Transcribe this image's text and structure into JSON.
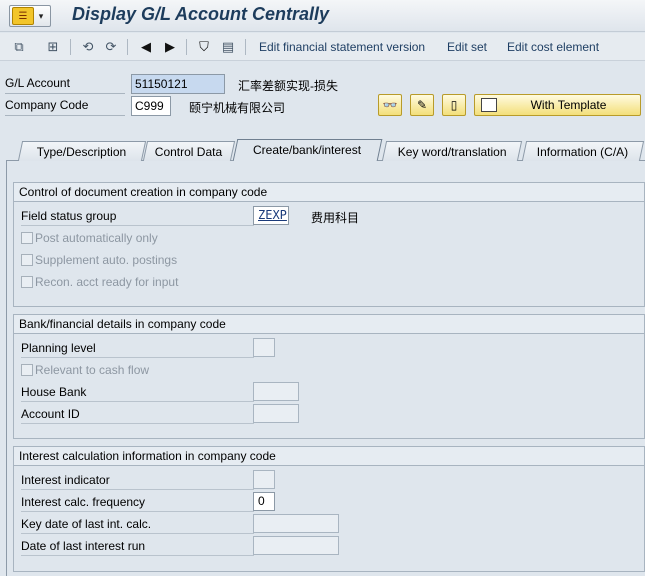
{
  "window": {
    "title": "Display G/L Account Centrally"
  },
  "toolbar": {
    "edit_fs_version": "Edit financial statement version",
    "edit_set": "Edit set",
    "edit_cost_element": "Edit cost element",
    "icons": [
      "other-object-icon",
      "hierarchy-icon",
      "previous-object-icon",
      "next-object-icon",
      "back-arrow-icon",
      "forward-arrow-icon",
      "filter-icon",
      "document-icon"
    ]
  },
  "header": {
    "gl_account_label": "G/L Account",
    "gl_account_value": "51150121",
    "gl_account_desc": "汇率差额实现-损失",
    "company_code_label": "Company Code",
    "company_code_value": "C999",
    "company_code_desc": "颐宁机械有限公司",
    "with_template_label": "With Template"
  },
  "tabs": [
    {
      "label": "Type/Description"
    },
    {
      "label": "Control Data"
    },
    {
      "label": "Create/bank/interest",
      "active": true
    },
    {
      "label": "Key word/translation"
    },
    {
      "label": "Information (C/A)"
    }
  ],
  "groups": {
    "doc_creation": {
      "title": "Control of document creation in company code",
      "field_status_group_label": "Field status group",
      "field_status_group_value": "ZEXP",
      "field_status_group_desc": "费用科目",
      "post_auto_label": "Post automatically only",
      "supplement_label": "Supplement auto. postings",
      "recon_label": "Recon. acct ready for input"
    },
    "bank": {
      "title": "Bank/financial details in company code",
      "planning_level_label": "Planning level",
      "relevant_cash_flow_label": "Relevant to cash flow",
      "house_bank_label": "House Bank",
      "account_id_label": "Account ID"
    },
    "interest": {
      "title": "Interest calculation information in company code",
      "interest_indicator_label": "Interest indicator",
      "interest_freq_label": "Interest calc. frequency",
      "interest_freq_value": "0",
      "key_date_label": "Key date of last int. calc.",
      "date_last_run_label": "Date of last interest run"
    }
  }
}
